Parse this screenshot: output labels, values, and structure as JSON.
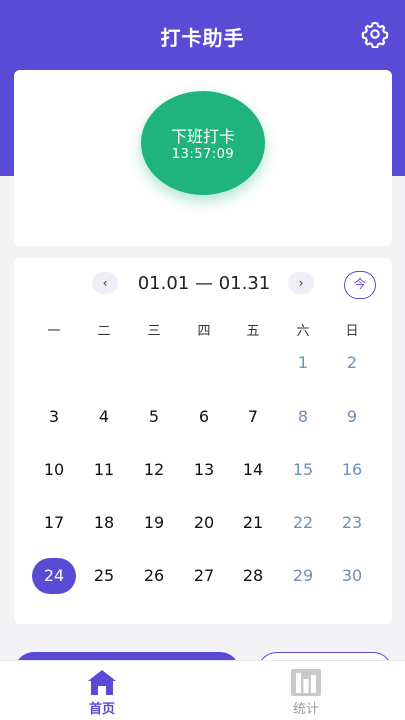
{
  "header": {
    "title": "打卡助手"
  },
  "punch": {
    "label": "下班打卡",
    "time": "13:57:09"
  },
  "calendar": {
    "range": "01.01 — 01.31",
    "prev": "‹",
    "next": "›",
    "today": "今",
    "weekdays": [
      "一",
      "二",
      "三",
      "四",
      "五",
      "六",
      "日"
    ],
    "weeks": [
      [
        "",
        "",
        "",
        "",
        "",
        "1",
        "2"
      ],
      [
        "3",
        "4",
        "5",
        "6",
        "7",
        "8",
        "9"
      ],
      [
        "10",
        "11",
        "12",
        "13",
        "14",
        "15",
        "16"
      ],
      [
        "17",
        "18",
        "19",
        "20",
        "21",
        "22",
        "23"
      ],
      [
        "24",
        "25",
        "26",
        "27",
        "28",
        "29",
        "30"
      ]
    ],
    "selected": "24"
  },
  "tabs": {
    "home": "首页",
    "stats": "统计"
  },
  "colors": {
    "accent": "#5a4bd6",
    "punch": "#1fb47e",
    "weekend": "#6f8fb9"
  }
}
